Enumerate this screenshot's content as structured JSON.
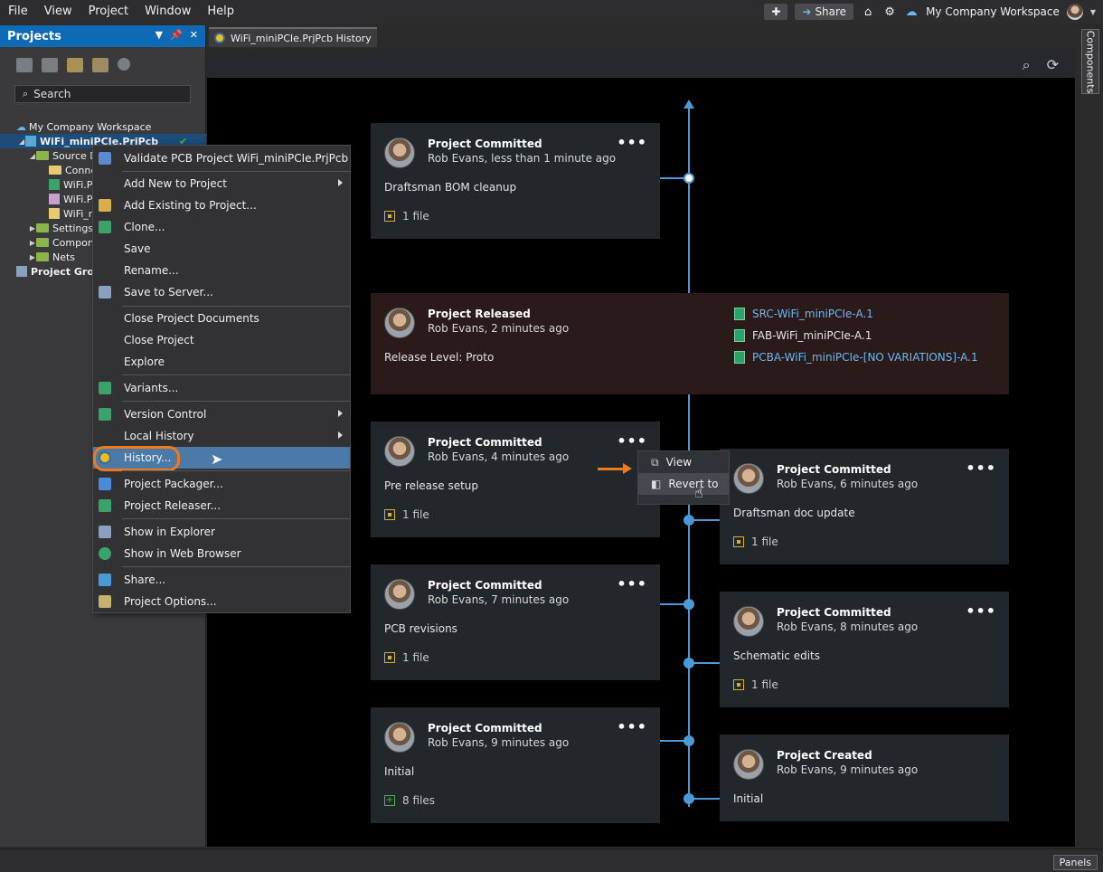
{
  "menubar": {
    "items": [
      "File",
      "View",
      "Project",
      "Window",
      "Help"
    ],
    "share_label": "Share",
    "workspace": "My Company Workspace"
  },
  "projects_panel": {
    "title": "Projects",
    "search_placeholder": "Search",
    "tree": [
      {
        "label": "My Company Workspace",
        "indent": 0
      },
      {
        "label": "WiFi_miniPCIe.PrjPcb",
        "indent": 1
      },
      {
        "label": "Source Documents",
        "indent": 2
      },
      {
        "label": "Connectors.SchDoc",
        "indent": 3
      },
      {
        "label": "WiFi.PcbDoc",
        "indent": 3
      },
      {
        "label": "WiFi.PrjPcb",
        "indent": 3
      },
      {
        "label": "WiFi_miniPCIe.OutJob",
        "indent": 3
      },
      {
        "label": "Settings",
        "indent": 2
      },
      {
        "label": "Components",
        "indent": 2
      },
      {
        "label": "Nets",
        "indent": 2
      },
      {
        "label": "Project Group",
        "indent": 0
      }
    ]
  },
  "doc_tab": {
    "label": "WiFi_miniPCIe.PrjPcb History"
  },
  "context_menu": {
    "items": [
      {
        "label": "Validate PCB Project WiFi_miniPCIe.PrjPcb",
        "icon_color": "#5a8ad0",
        "sub": false
      },
      {
        "label": "Add New to Project",
        "icon_color": "",
        "sub": true
      },
      {
        "label": "Add Existing to Project...",
        "icon_color": "#d8b04a",
        "sub": false
      },
      {
        "label": "Clone...",
        "icon_color": "#3aa36b",
        "sub": false
      },
      {
        "label": "Save",
        "icon_color": "",
        "sub": false
      },
      {
        "label": "Rename...",
        "icon_color": "",
        "sub": false
      },
      {
        "label": "Save to Server...",
        "icon_color": "#8aa0c0",
        "sub": false
      },
      {
        "label": "Close Project Documents",
        "icon_color": "",
        "sub": false
      },
      {
        "label": "Close Project",
        "icon_color": "",
        "sub": false
      },
      {
        "label": "Explore",
        "icon_color": "",
        "sub": false
      },
      {
        "label": "Variants...",
        "icon_color": "#3aa36b",
        "sub": false
      },
      {
        "label": "Version Control",
        "icon_color": "#3aa36b",
        "sub": true
      },
      {
        "label": "Local History",
        "icon_color": "",
        "sub": true
      },
      {
        "label": "History...",
        "icon_color": "#e8c020",
        "sub": false
      },
      {
        "label": "Project Packager...",
        "icon_color": "#4a8ad8",
        "sub": false
      },
      {
        "label": "Project Releaser...",
        "icon_color": "#3aa36b",
        "sub": false
      },
      {
        "label": "Show in Explorer",
        "icon_color": "#8aa0c0",
        "sub": false
      },
      {
        "label": "Show in Web Browser",
        "icon_color": "#3aa36b",
        "sub": false
      },
      {
        "label": "Share...",
        "icon_color": "#4a9ad8",
        "sub": false
      },
      {
        "label": "Project Options...",
        "icon_color": "#c8b070",
        "sub": false
      }
    ]
  },
  "history": {
    "cards": [
      {
        "title": "Project Committed",
        "subtitle": "Rob Evans, less than 1 minute ago",
        "message": "Draftsman BOM cleanup",
        "files": "1 file"
      },
      {
        "title": "Project Released",
        "subtitle": "Rob Evans, 2 minutes ago",
        "message": "Release Level: Proto",
        "files": ""
      },
      {
        "title": "Project Committed",
        "subtitle": "Rob Evans, 4 minutes ago",
        "message": "Pre release setup",
        "files": "1 file"
      },
      {
        "title": "Project Committed",
        "subtitle": "Rob Evans, 6 minutes ago",
        "message": "Draftsman doc update",
        "files": "1 file"
      },
      {
        "title": "Project Committed",
        "subtitle": "Rob Evans, 7 minutes ago",
        "message": "PCB revisions",
        "files": "1 file"
      },
      {
        "title": "Project Committed",
        "subtitle": "Rob Evans, 8 minutes ago",
        "message": "Schematic edits",
        "files": "1 file"
      },
      {
        "title": "Project Committed",
        "subtitle": "Rob Evans, 9 minutes ago",
        "message": "Initial",
        "files": "8 files"
      },
      {
        "title": "Project Created",
        "subtitle": "Rob Evans, 9 minutes ago",
        "message": "Initial",
        "files": ""
      }
    ],
    "release_items": [
      "SRC-WiFi_miniPCIe-A.1",
      "FAB-WiFi_miniPCIe-A.1",
      "PCBA-WiFi_miniPCIe-[NO VARIATIONS]-A.1"
    ],
    "mini_menu": {
      "view": "View",
      "revert": "Revert to"
    }
  },
  "right_sidebar": {
    "components_tab": "Components"
  },
  "statusbar": {
    "panels": "Panels"
  },
  "colors": {
    "accent": "#0e6ab5",
    "timeline": "#4a9ad8",
    "highlight_ring": "#f07a1a",
    "link": "#6ab8f0"
  }
}
